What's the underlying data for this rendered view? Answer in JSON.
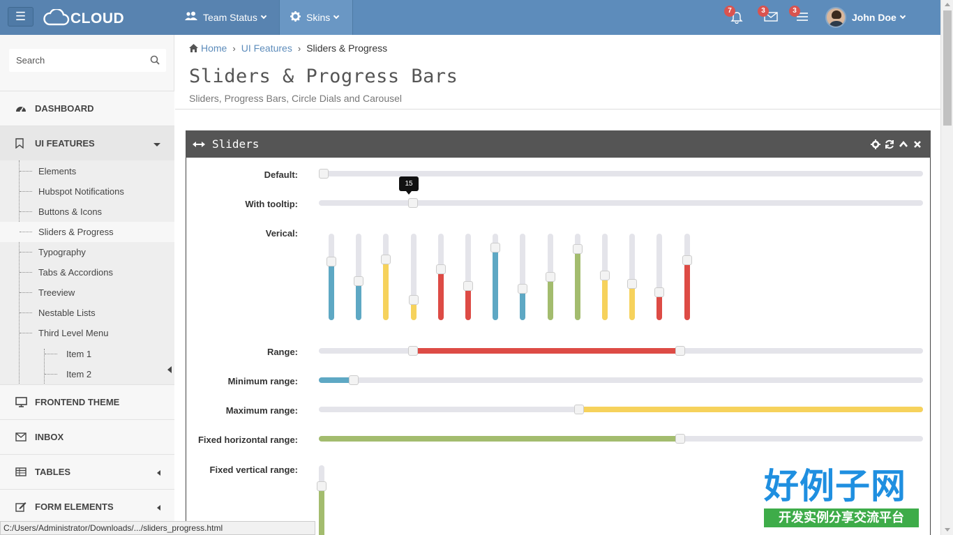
{
  "topbar": {
    "brand": "CLOUD",
    "nav": [
      {
        "label": "Team Status",
        "icon": "users-icon"
      },
      {
        "label": "Skins",
        "icon": "gear-icon"
      }
    ],
    "notifications": [
      {
        "count": "7",
        "icon": "bell-icon"
      },
      {
        "count": "3",
        "icon": "envelope-icon"
      },
      {
        "count": "3",
        "icon": "tasks-icon"
      }
    ],
    "user": {
      "name": "John Doe"
    }
  },
  "sidebar": {
    "search_placeholder": "Search",
    "menu": [
      {
        "label": "DASHBOARD",
        "icon": "dashboard-icon"
      },
      {
        "label": "UI FEATURES",
        "icon": "bookmark-icon"
      },
      {
        "label": "FRONTEND THEME",
        "icon": "monitor-icon"
      },
      {
        "label": "INBOX",
        "icon": "envelope-icon"
      },
      {
        "label": "TABLES",
        "icon": "table-icon"
      },
      {
        "label": "FORM ELEMENTS",
        "icon": "edit-icon"
      }
    ],
    "submenu": [
      "Elements",
      "Hubspot Notifications",
      "Buttons & Icons",
      "Sliders & Progress",
      "Typography",
      "Tabs & Accordions",
      "Treeview",
      "Nestable Lists",
      "Third Level Menu"
    ],
    "third_level": [
      "Item 1",
      "Item 2"
    ],
    "active_submenu": "Sliders & Progress"
  },
  "breadcrumb": {
    "home": "Home",
    "section": "UI Features",
    "current": "Sliders & Progress"
  },
  "page": {
    "title": "Sliders & Progress Bars",
    "subtitle": "Sliders, Progress Bars, Circle Dials and Carousel"
  },
  "panel": {
    "title": "Sliders",
    "tools": [
      "gear-icon",
      "refresh-icon",
      "chevron-up-icon",
      "close-icon"
    ]
  },
  "sliders": {
    "default": {
      "label": "Default:",
      "value": 0
    },
    "tooltip": {
      "label": "With tooltip:",
      "value": 15,
      "tooltip_text": "15"
    },
    "vertical": {
      "label": "Verical:",
      "items": [
        {
          "value": 70,
          "color": "#5ea8c4"
        },
        {
          "value": 45,
          "color": "#5ea8c4"
        },
        {
          "value": 73,
          "color": "#f6d25c"
        },
        {
          "value": 20,
          "color": "#f6d25c"
        },
        {
          "value": 60,
          "color": "#dd4b45"
        },
        {
          "value": 38,
          "color": "#dd4b45"
        },
        {
          "value": 88,
          "color": "#5ea8c4"
        },
        {
          "value": 35,
          "color": "#5ea8c4"
        },
        {
          "value": 50,
          "color": "#a3bc6e"
        },
        {
          "value": 86,
          "color": "#a3bc6e"
        },
        {
          "value": 52,
          "color": "#f6d25c"
        },
        {
          "value": 41,
          "color": "#f6d25c"
        },
        {
          "value": 30,
          "color": "#dd4b45"
        },
        {
          "value": 72,
          "color": "#dd4b45"
        }
      ]
    },
    "range": {
      "label": "Range:",
      "from": 15,
      "to": 60,
      "color": "#dd4b45"
    },
    "min_range": {
      "label": "Minimum range:",
      "value": 5,
      "color": "#5ea8c4"
    },
    "max_range": {
      "label": "Maximum range:",
      "value": 43,
      "color": "#f6d25c"
    },
    "fixed_h": {
      "label": "Fixed horizontal range:",
      "value": 60,
      "color": "#a3bc6e"
    },
    "fixed_v": {
      "label": "Fixed vertical range:",
      "value": 80,
      "color": "#a3bc6e"
    }
  },
  "statusbar": {
    "url": "C:/Users/Administrator/Downloads/.../sliders_progress.html"
  },
  "watermark": {
    "main": "好例子网",
    "sub": "开发实例分享交流平台"
  }
}
